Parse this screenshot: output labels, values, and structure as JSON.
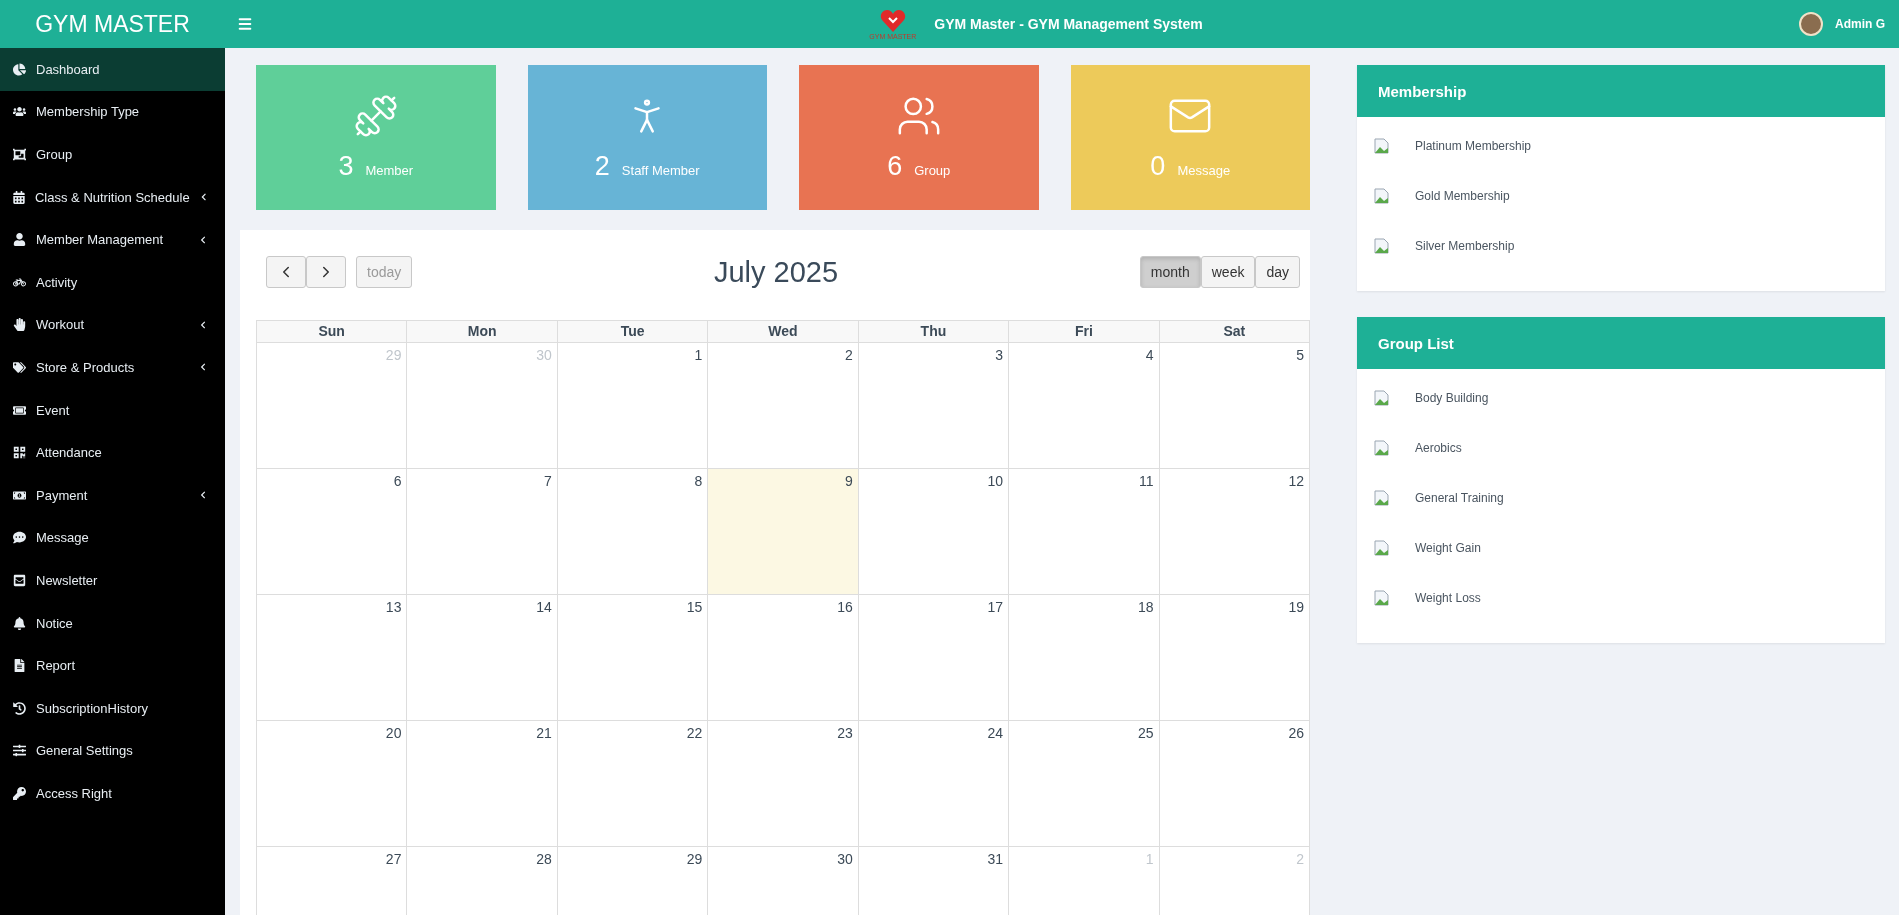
{
  "topbar": {
    "brand": "GYM MASTER",
    "logo_text": "GYM MASTER",
    "title": "GYM Master - GYM Management System",
    "user": "Admin G"
  },
  "sidebar": {
    "items": [
      {
        "label": "Dashboard",
        "selected": true,
        "has_submenu": false
      },
      {
        "label": "Membership Type",
        "selected": false,
        "has_submenu": false
      },
      {
        "label": "Group",
        "selected": false,
        "has_submenu": false
      },
      {
        "label": "Class & Nutrition Schedule",
        "selected": false,
        "has_submenu": true
      },
      {
        "label": "Member Management",
        "selected": false,
        "has_submenu": true
      },
      {
        "label": "Activity",
        "selected": false,
        "has_submenu": false
      },
      {
        "label": "Workout",
        "selected": false,
        "has_submenu": true
      },
      {
        "label": "Store & Products",
        "selected": false,
        "has_submenu": true
      },
      {
        "label": "Event",
        "selected": false,
        "has_submenu": false
      },
      {
        "label": "Attendance",
        "selected": false,
        "has_submenu": false
      },
      {
        "label": "Payment",
        "selected": false,
        "has_submenu": true
      },
      {
        "label": "Message",
        "selected": false,
        "has_submenu": false
      },
      {
        "label": "Newsletter",
        "selected": false,
        "has_submenu": false
      },
      {
        "label": "Notice",
        "selected": false,
        "has_submenu": false
      },
      {
        "label": "Report",
        "selected": false,
        "has_submenu": false
      },
      {
        "label": "SubscriptionHistory",
        "selected": false,
        "has_submenu": false
      },
      {
        "label": "General Settings",
        "selected": false,
        "has_submenu": false
      },
      {
        "label": "Access Right",
        "selected": false,
        "has_submenu": false
      }
    ]
  },
  "stats": [
    {
      "count": "3",
      "label": "Member",
      "color": "#5fcf99"
    },
    {
      "count": "2",
      "label": "Staff Member",
      "color": "#67b4d6"
    },
    {
      "count": "6",
      "label": "Group",
      "color": "#e87352"
    },
    {
      "count": "0",
      "label": "Message",
      "color": "#edca5a"
    }
  ],
  "calendar": {
    "title": "July 2025",
    "today_button": {
      "label": "today",
      "disabled": true
    },
    "views": [
      {
        "label": "month",
        "selected": true
      },
      {
        "label": "week",
        "selected": false
      },
      {
        "label": "day",
        "selected": false
      }
    ],
    "weekdays": [
      "Sun",
      "Mon",
      "Tue",
      "Wed",
      "Thu",
      "Fri",
      "Sat"
    ],
    "weeks": [
      [
        {
          "day": "29",
          "other_month": true,
          "today": false
        },
        {
          "day": "30",
          "other_month": true,
          "today": false
        },
        {
          "day": "1",
          "other_month": false,
          "today": false
        },
        {
          "day": "2",
          "other_month": false,
          "today": false
        },
        {
          "day": "3",
          "other_month": false,
          "today": false
        },
        {
          "day": "4",
          "other_month": false,
          "today": false
        },
        {
          "day": "5",
          "other_month": false,
          "today": false
        }
      ],
      [
        {
          "day": "6",
          "other_month": false,
          "today": false
        },
        {
          "day": "7",
          "other_month": false,
          "today": false
        },
        {
          "day": "8",
          "other_month": false,
          "today": false
        },
        {
          "day": "9",
          "other_month": false,
          "today": true
        },
        {
          "day": "10",
          "other_month": false,
          "today": false
        },
        {
          "day": "11",
          "other_month": false,
          "today": false
        },
        {
          "day": "12",
          "other_month": false,
          "today": false
        }
      ],
      [
        {
          "day": "13",
          "other_month": false,
          "today": false
        },
        {
          "day": "14",
          "other_month": false,
          "today": false
        },
        {
          "day": "15",
          "other_month": false,
          "today": false
        },
        {
          "day": "16",
          "other_month": false,
          "today": false
        },
        {
          "day": "17",
          "other_month": false,
          "today": false
        },
        {
          "day": "18",
          "other_month": false,
          "today": false
        },
        {
          "day": "19",
          "other_month": false,
          "today": false
        }
      ],
      [
        {
          "day": "20",
          "other_month": false,
          "today": false
        },
        {
          "day": "21",
          "other_month": false,
          "today": false
        },
        {
          "day": "22",
          "other_month": false,
          "today": false
        },
        {
          "day": "23",
          "other_month": false,
          "today": false
        },
        {
          "day": "24",
          "other_month": false,
          "today": false
        },
        {
          "day": "25",
          "other_month": false,
          "today": false
        },
        {
          "day": "26",
          "other_month": false,
          "today": false
        }
      ],
      [
        {
          "day": "27",
          "other_month": false,
          "today": false
        },
        {
          "day": "28",
          "other_month": false,
          "today": false
        },
        {
          "day": "29",
          "other_month": false,
          "today": false
        },
        {
          "day": "30",
          "other_month": false,
          "today": false
        },
        {
          "day": "31",
          "other_month": false,
          "today": false
        },
        {
          "day": "1",
          "other_month": true,
          "today": false
        },
        {
          "day": "2",
          "other_month": true,
          "today": false
        }
      ]
    ]
  },
  "panels": [
    {
      "title": "Membership",
      "items": [
        "Platinum Membership",
        "Gold Membership",
        "Silver Membership"
      ]
    },
    {
      "title": "Group List",
      "items": [
        "Body Building",
        "Aerobics",
        "General Training",
        "Weight Gain",
        "Weight Loss"
      ]
    }
  ]
}
